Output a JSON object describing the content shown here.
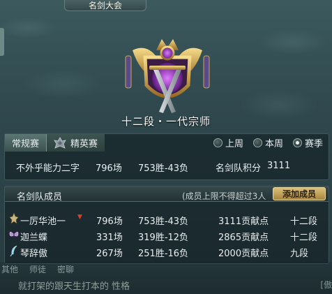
{
  "window_title": "名剑大会",
  "rank_title": "十二段・一代宗师",
  "tabs": [
    {
      "label": "常规赛",
      "active": true
    },
    {
      "label": "精英赛",
      "active": false
    }
  ],
  "periods": [
    {
      "label": "上周",
      "selected": false
    },
    {
      "label": "本周",
      "selected": false
    },
    {
      "label": "赛季",
      "selected": true
    }
  ],
  "team_stats": {
    "name": "不外乎能力二字",
    "matches": "796场",
    "record": "753胜-43负",
    "score_label": "名剑队积分",
    "score": "3111"
  },
  "members_section": {
    "title": "名剑队成员",
    "limit_note": "(成员上限不得超过3人",
    "add_button": "添加成员"
  },
  "members": [
    {
      "name": "一厉华池一",
      "matches": "796场",
      "record": "753胜-43负",
      "contribution": "3111贡献点",
      "rank": "十二段",
      "icon": "sword-emblem-icon",
      "leader": true
    },
    {
      "name": "迦兰蝶",
      "matches": "331场",
      "record": "319胜-12负",
      "contribution": "2865贡献点",
      "rank": "十二段",
      "icon": "butterfly-icon",
      "leader": false
    },
    {
      "name": "琴辞傲",
      "matches": "267场",
      "record": "251胜-16负",
      "contribution": "2000贡献点",
      "rank": "九段",
      "icon": "feather-icon",
      "leader": false
    }
  ],
  "chat": {
    "tabs": [
      "其他",
      "师徒",
      "密聊"
    ],
    "line": "  就打架的跟天生打本的 性格",
    "right": "[傲"
  },
  "colors": {
    "accent_gold": "#d9c07a",
    "background": "#2a4248",
    "leader_marker": "#d7442a"
  }
}
